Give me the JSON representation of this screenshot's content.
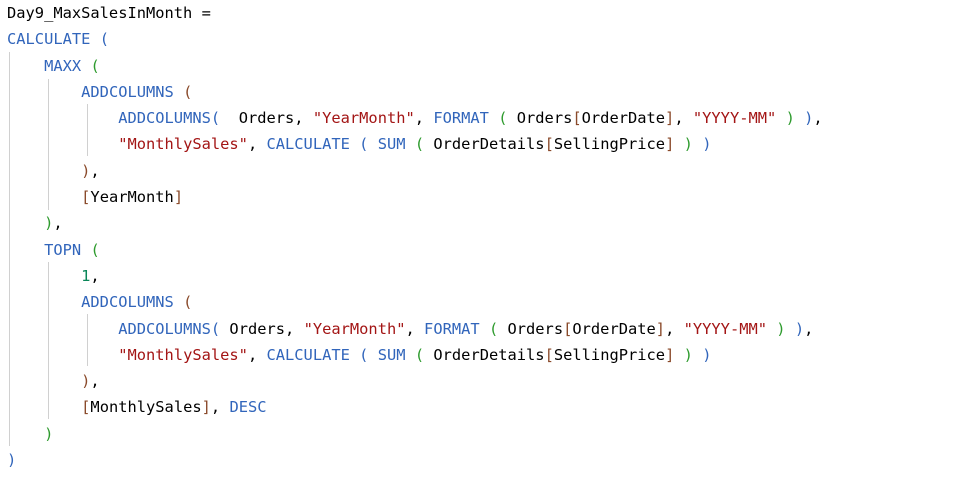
{
  "editor": {
    "lines": [
      [
        {
          "t": "Day9_MaxSalesInMonth =",
          "c": "text"
        }
      ],
      [
        {
          "t": "CALCULATE",
          "c": "func"
        },
        {
          "t": " ",
          "c": "text"
        },
        {
          "t": "(",
          "c": "p1"
        }
      ],
      [
        {
          "t": "    ",
          "c": "text"
        },
        {
          "t": "MAXX",
          "c": "func"
        },
        {
          "t": " ",
          "c": "text"
        },
        {
          "t": "(",
          "c": "p2"
        }
      ],
      [
        {
          "t": "        ",
          "c": "text"
        },
        {
          "t": "ADDCOLUMNS",
          "c": "func"
        },
        {
          "t": " ",
          "c": "text"
        },
        {
          "t": "(",
          "c": "p3"
        }
      ],
      [
        {
          "t": "            ",
          "c": "text"
        },
        {
          "t": "ADDCOLUMNS",
          "c": "func"
        },
        {
          "t": "(",
          "c": "p1"
        },
        {
          "t": "  Orders, ",
          "c": "text"
        },
        {
          "t": "\"YearMonth\"",
          "c": "str"
        },
        {
          "t": ", ",
          "c": "text"
        },
        {
          "t": "FORMAT",
          "c": "func"
        },
        {
          "t": " ",
          "c": "text"
        },
        {
          "t": "(",
          "c": "p2"
        },
        {
          "t": " Orders",
          "c": "text"
        },
        {
          "t": "[",
          "c": "bracket"
        },
        {
          "t": "OrderDate",
          "c": "col"
        },
        {
          "t": "]",
          "c": "bracket"
        },
        {
          "t": ", ",
          "c": "text"
        },
        {
          "t": "\"YYYY-MM\"",
          "c": "str"
        },
        {
          "t": " ",
          "c": "text"
        },
        {
          "t": ")",
          "c": "p2"
        },
        {
          "t": " ",
          "c": "text"
        },
        {
          "t": ")",
          "c": "p1"
        },
        {
          "t": ",",
          "c": "text"
        }
      ],
      [
        {
          "t": "            ",
          "c": "text"
        },
        {
          "t": "\"MonthlySales\"",
          "c": "str"
        },
        {
          "t": ", ",
          "c": "text"
        },
        {
          "t": "CALCULATE",
          "c": "func"
        },
        {
          "t": " ",
          "c": "text"
        },
        {
          "t": "(",
          "c": "p1"
        },
        {
          "t": " ",
          "c": "text"
        },
        {
          "t": "SUM",
          "c": "func"
        },
        {
          "t": " ",
          "c": "text"
        },
        {
          "t": "(",
          "c": "p2"
        },
        {
          "t": " OrderDetails",
          "c": "text"
        },
        {
          "t": "[",
          "c": "bracket"
        },
        {
          "t": "SellingPrice",
          "c": "col"
        },
        {
          "t": "]",
          "c": "bracket"
        },
        {
          "t": " ",
          "c": "text"
        },
        {
          "t": ")",
          "c": "p2"
        },
        {
          "t": " ",
          "c": "text"
        },
        {
          "t": ")",
          "c": "p1"
        }
      ],
      [
        {
          "t": "        ",
          "c": "text"
        },
        {
          "t": ")",
          "c": "p3"
        },
        {
          "t": ",",
          "c": "text"
        }
      ],
      [
        {
          "t": "        ",
          "c": "text"
        },
        {
          "t": "[",
          "c": "bracket"
        },
        {
          "t": "YearMonth",
          "c": "col"
        },
        {
          "t": "]",
          "c": "bracket"
        }
      ],
      [
        {
          "t": "    ",
          "c": "text"
        },
        {
          "t": ")",
          "c": "p2"
        },
        {
          "t": ",",
          "c": "text"
        }
      ],
      [
        {
          "t": "    ",
          "c": "text"
        },
        {
          "t": "TOPN",
          "c": "func"
        },
        {
          "t": " ",
          "c": "text"
        },
        {
          "t": "(",
          "c": "p2"
        }
      ],
      [
        {
          "t": "        ",
          "c": "text"
        },
        {
          "t": "1",
          "c": "num"
        },
        {
          "t": ",",
          "c": "text"
        }
      ],
      [
        {
          "t": "        ",
          "c": "text"
        },
        {
          "t": "ADDCOLUMNS",
          "c": "func"
        },
        {
          "t": " ",
          "c": "text"
        },
        {
          "t": "(",
          "c": "p3"
        }
      ],
      [
        {
          "t": "            ",
          "c": "text"
        },
        {
          "t": "ADDCOLUMNS",
          "c": "func"
        },
        {
          "t": "(",
          "c": "p1"
        },
        {
          "t": " Orders, ",
          "c": "text"
        },
        {
          "t": "\"YearMonth\"",
          "c": "str"
        },
        {
          "t": ", ",
          "c": "text"
        },
        {
          "t": "FORMAT",
          "c": "func"
        },
        {
          "t": " ",
          "c": "text"
        },
        {
          "t": "(",
          "c": "p2"
        },
        {
          "t": " Orders",
          "c": "text"
        },
        {
          "t": "[",
          "c": "bracket"
        },
        {
          "t": "OrderDate",
          "c": "col"
        },
        {
          "t": "]",
          "c": "bracket"
        },
        {
          "t": ", ",
          "c": "text"
        },
        {
          "t": "\"YYYY-MM\"",
          "c": "str"
        },
        {
          "t": " ",
          "c": "text"
        },
        {
          "t": ")",
          "c": "p2"
        },
        {
          "t": " ",
          "c": "text"
        },
        {
          "t": ")",
          "c": "p1"
        },
        {
          "t": ",",
          "c": "text"
        }
      ],
      [
        {
          "t": "            ",
          "c": "text"
        },
        {
          "t": "\"MonthlySales\"",
          "c": "str"
        },
        {
          "t": ", ",
          "c": "text"
        },
        {
          "t": "CALCULATE",
          "c": "func"
        },
        {
          "t": " ",
          "c": "text"
        },
        {
          "t": "(",
          "c": "p1"
        },
        {
          "t": " ",
          "c": "text"
        },
        {
          "t": "SUM",
          "c": "func"
        },
        {
          "t": " ",
          "c": "text"
        },
        {
          "t": "(",
          "c": "p2"
        },
        {
          "t": " OrderDetails",
          "c": "text"
        },
        {
          "t": "[",
          "c": "bracket"
        },
        {
          "t": "SellingPrice",
          "c": "col"
        },
        {
          "t": "]",
          "c": "bracket"
        },
        {
          "t": " ",
          "c": "text"
        },
        {
          "t": ")",
          "c": "p2"
        },
        {
          "t": " ",
          "c": "text"
        },
        {
          "t": ")",
          "c": "p1"
        }
      ],
      [
        {
          "t": "        ",
          "c": "text"
        },
        {
          "t": ")",
          "c": "p3"
        },
        {
          "t": ",",
          "c": "text"
        }
      ],
      [
        {
          "t": "        ",
          "c": "text"
        },
        {
          "t": "[",
          "c": "bracket"
        },
        {
          "t": "MonthlySales",
          "c": "col"
        },
        {
          "t": "]",
          "c": "bracket"
        },
        {
          "t": ", ",
          "c": "text"
        },
        {
          "t": "DESC",
          "c": "kw"
        }
      ],
      [
        {
          "t": "    ",
          "c": "text"
        },
        {
          "t": ")",
          "c": "p2"
        }
      ],
      [
        {
          "t": ")",
          "c": "p1"
        }
      ]
    ]
  },
  "colors": {
    "text": "#000000",
    "function": "#3165bb",
    "string": "#a31515",
    "number": "#098658",
    "bracket": "#8a4a2a",
    "paren_level1": "#3165bb",
    "paren_level2": "#2e9b2e",
    "paren_level3": "#8a4a2a",
    "indent_guide": "#d0d0d0"
  }
}
